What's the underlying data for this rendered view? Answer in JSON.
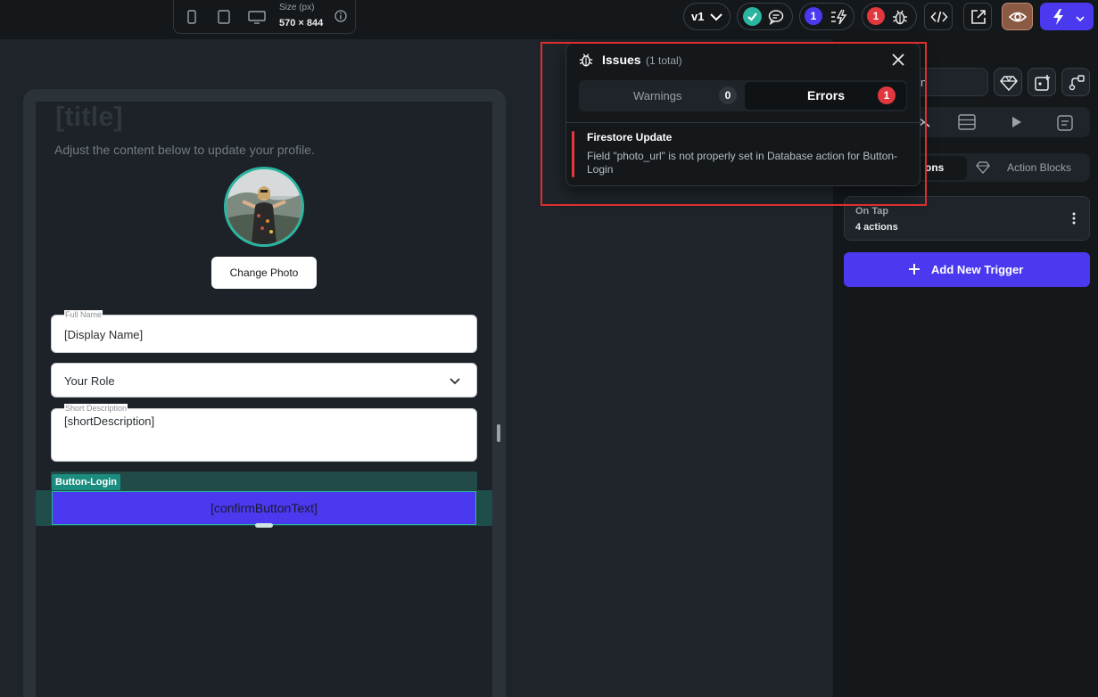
{
  "toolbar": {
    "size_label": "Size (px)",
    "size_value": "570 × 844",
    "version": "v1",
    "warnings_badge": "1",
    "errors_badge": "1"
  },
  "canvas": {
    "title": "[title]",
    "subtitle": "Adjust the content below to update your profile.",
    "change_photo": "Change Photo",
    "full_name_label": "Full Name",
    "full_name_value": "[Display Name]",
    "role_value": "Your Role",
    "short_desc_label": "Short Description",
    "short_desc_value": "[shortDescription]",
    "button_tag": "Button-Login",
    "confirm_button": "[confirmButtonText]"
  },
  "right_panel": {
    "input_partial": "n",
    "seg_actions": "ons",
    "seg_blocks": "Action Blocks",
    "trigger_title": "On Tap",
    "trigger_count": "4 actions",
    "add_trigger": "Add New Trigger"
  },
  "issues": {
    "title": "Issues",
    "count": "(1 total)",
    "warnings_label": "Warnings",
    "warnings_count": "0",
    "errors_label": "Errors",
    "errors_count": "1",
    "items": [
      {
        "heading": "Firestore Update",
        "description": "Field \"photo_url\" is not properly set in Database action for Button-Login"
      }
    ]
  },
  "colors": {
    "accent": "#4b39ef",
    "teal": "#2bb5a0",
    "error": "#e0383e",
    "highlight_box": "#e02e2e"
  },
  "icons": [
    "mobile-icon",
    "tablet-icon",
    "desktop-icon",
    "info-icon",
    "chevron-down-icon",
    "check-icon",
    "chat-icon",
    "lightning-list-icon",
    "bug-icon",
    "code-icon",
    "open-external-icon",
    "eye-icon",
    "bolt-icon",
    "diamond-icon",
    "add-widget-icon",
    "flow-icon",
    "tree-icon",
    "database-icon",
    "play-icon",
    "list-icon",
    "plus-icon",
    "kebab-icon",
    "close-icon"
  ]
}
